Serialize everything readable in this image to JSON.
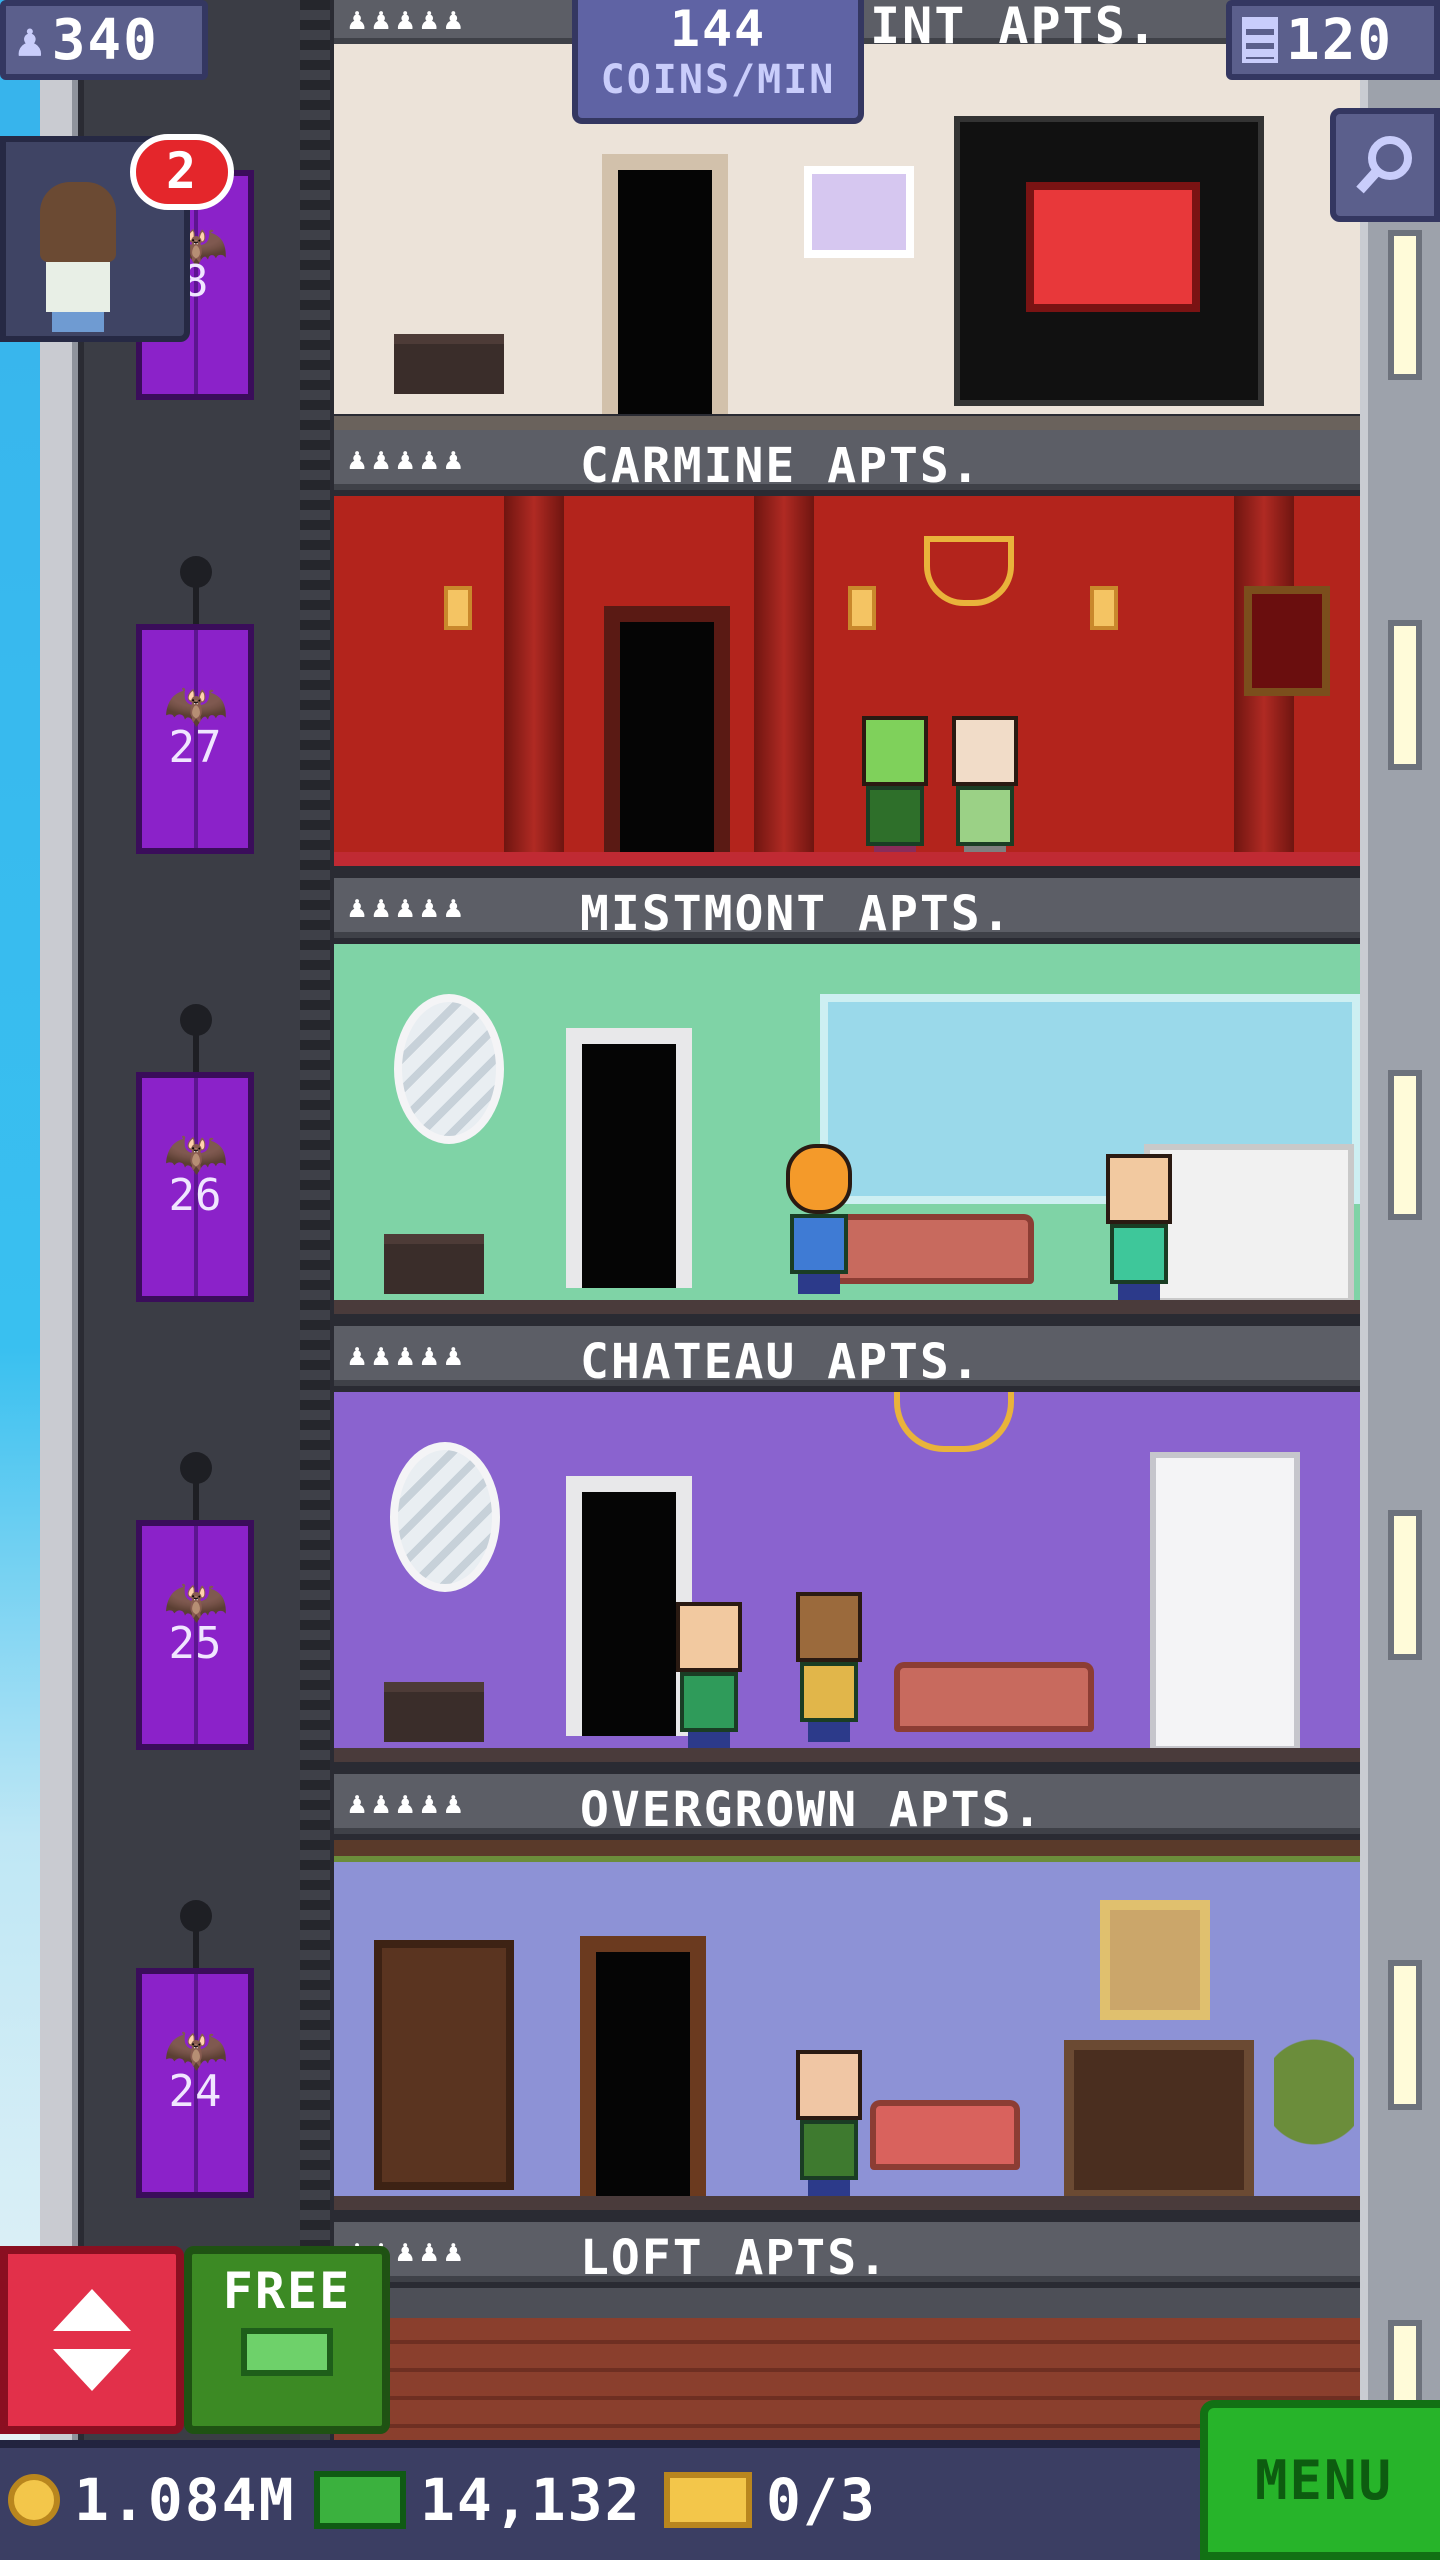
{
  "hud": {
    "population": "340",
    "coins_per_min_value": "144",
    "coins_per_min_unit": "COINS/MIN",
    "top_floor_partial": "INT APTS.",
    "floors_count": "120",
    "notification_count": "2"
  },
  "elevator": {
    "top_car_partial_number": "8",
    "cars": [
      {
        "floor": "27"
      },
      {
        "floor": "26"
      },
      {
        "floor": "25"
      },
      {
        "floor": "24"
      }
    ]
  },
  "floors": [
    {
      "name": "CARMINE APTS.",
      "residents": "♟♟♟♟♟",
      "wall_color": "#b3241c"
    },
    {
      "name": "MISTMONT APTS.",
      "residents": "♟♟♟♟♟",
      "wall_color": "#7fd3a6"
    },
    {
      "name": "CHATEAU APTS.",
      "residents": "♟♟♟♟♟",
      "wall_color": "#8a63cf"
    },
    {
      "name": "OVERGROWN APTS.",
      "residents": "♟♟♟♟♟",
      "wall_color": "#8d92d6"
    },
    {
      "name": "LOFT APTS.",
      "residents": "♟♟♟♟♟",
      "wall_color": "#8a3f2d"
    }
  ],
  "top_floor_residents": "♟♟♟♟♟",
  "controls": {
    "free_label": "FREE",
    "menu_label": "MENU"
  },
  "bottom_stats": {
    "coins": "1.084M",
    "bux": "14,132",
    "tickets": "0/3"
  },
  "icons": [
    "person-icon",
    "floors-icon",
    "magnifier-icon",
    "elevator-arrows-icon",
    "coin-icon",
    "bux-icon",
    "ticket-icon",
    "bat-icon"
  ]
}
